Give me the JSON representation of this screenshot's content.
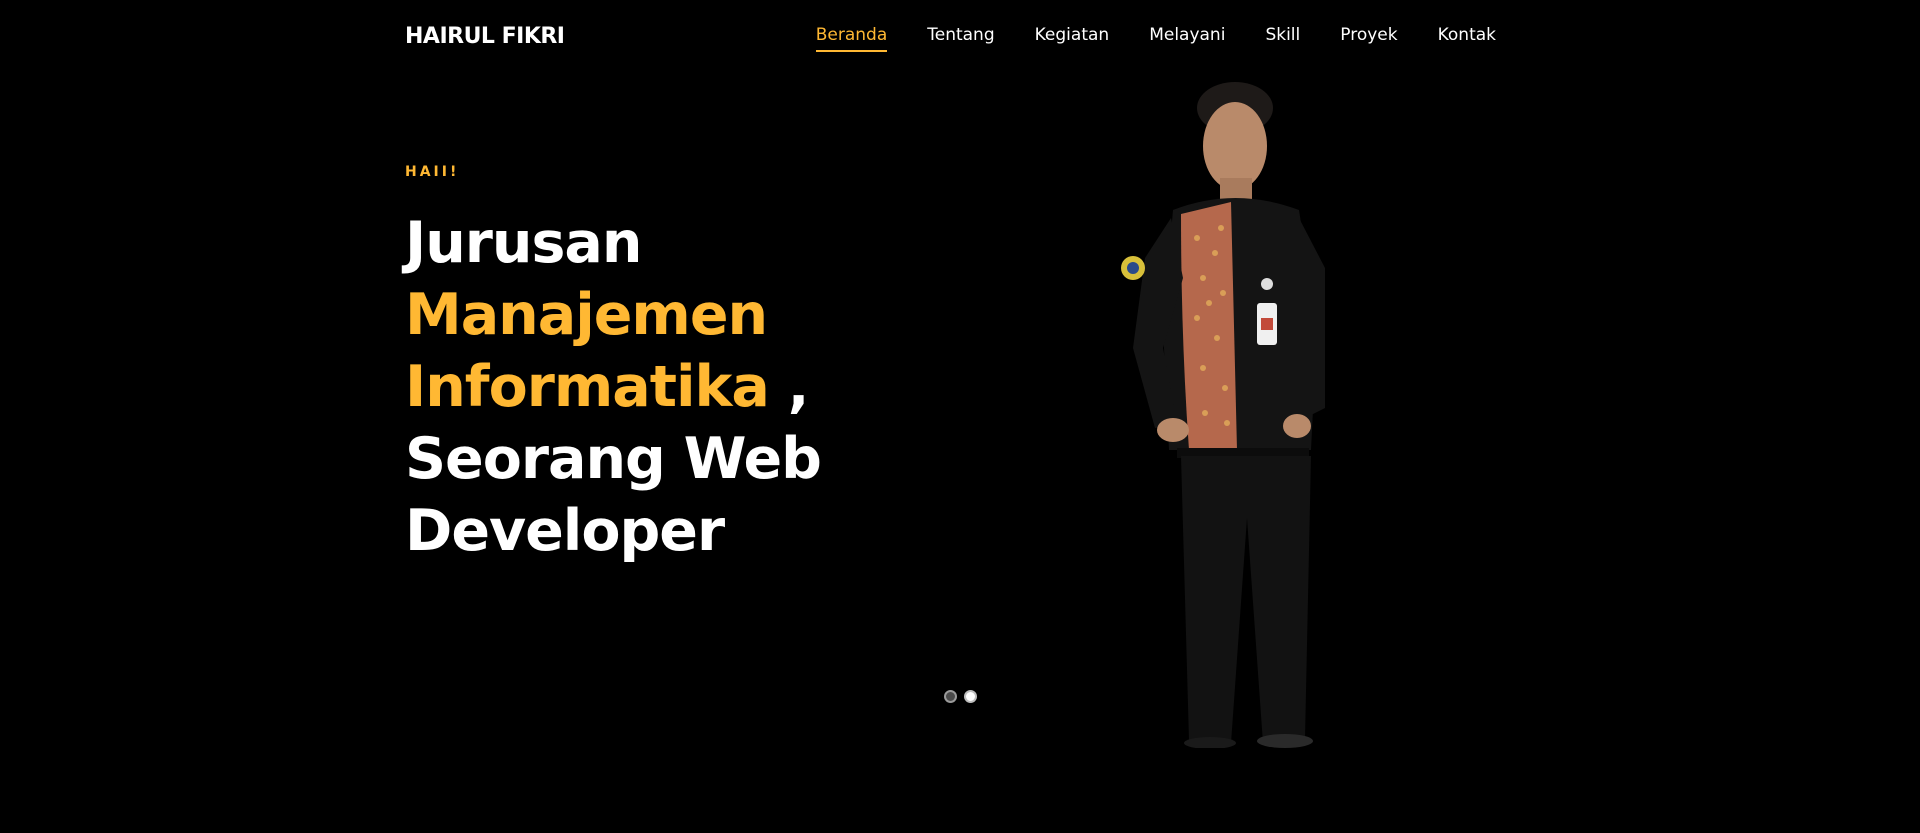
{
  "header": {
    "logo": "HAIRUL FIKRI",
    "nav": [
      {
        "label": "Beranda",
        "active": true
      },
      {
        "label": "Tentang",
        "active": false
      },
      {
        "label": "Kegiatan",
        "active": false
      },
      {
        "label": "Melayani",
        "active": false
      },
      {
        "label": "Skill",
        "active": false
      },
      {
        "label": "Proyek",
        "active": false
      },
      {
        "label": "Kontak",
        "active": false
      }
    ]
  },
  "hero": {
    "eyebrow": "HAII!",
    "line1": "Jurusan",
    "accent1": "Manajemen",
    "accent2": "Informatika",
    "comma": " ,",
    "line3": "Seorang Web",
    "line4": "Developer"
  },
  "slider": {
    "count": 2,
    "active_index": 1
  },
  "colors": {
    "accent": "#ffb833",
    "background": "#000000",
    "text": "#ffffff"
  }
}
